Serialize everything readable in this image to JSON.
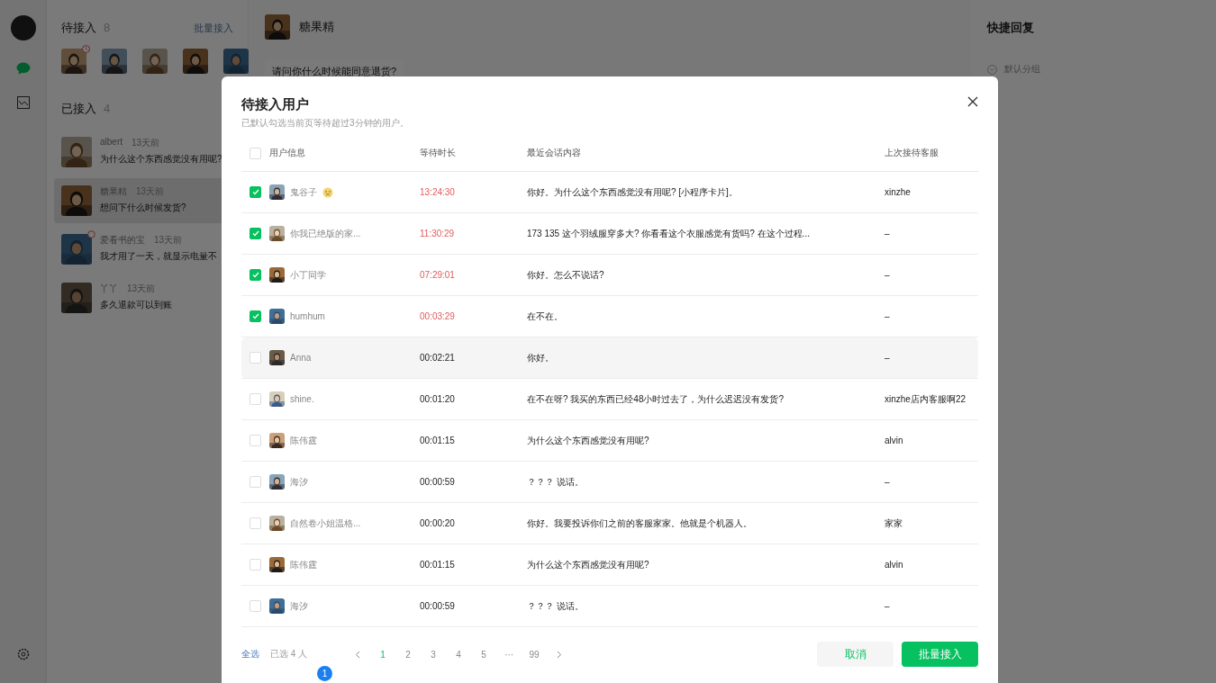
{
  "rail": {
    "nav": [
      {
        "kind": "chat",
        "selected": true
      },
      {
        "kind": "chart",
        "selected": false
      }
    ]
  },
  "waiting": {
    "title": "待接入",
    "count": "8",
    "action": "批量接入",
    "avatars": [
      {
        "alert": true
      },
      {
        "alert": false
      },
      {
        "alert": false
      },
      {
        "alert": false
      },
      {
        "alert": false
      }
    ]
  },
  "connected": {
    "title": "已接入",
    "count": "4",
    "items": [
      {
        "name": "albert",
        "time": "13天前",
        "message": "为什么这个东西感觉没有用呢?",
        "selected": false,
        "unread": false
      },
      {
        "name": "糖果精",
        "time": "13天前",
        "message": "想问下什么时候发货?",
        "selected": true,
        "unread": false
      },
      {
        "name": "爱看书的宝",
        "time": "13天前",
        "message": "我才用了一天，就显示电量不",
        "selected": false,
        "unread": true
      },
      {
        "name": "丫丫",
        "time": "13天前",
        "message": "多久退款可以到账",
        "selected": false,
        "unread": false
      }
    ]
  },
  "chat": {
    "name": "糖果精",
    "messages": [
      "请问你什么时候能同意退货?"
    ]
  },
  "quick_reply": {
    "title": "快捷回复",
    "groups": [
      {
        "label": "默认分组",
        "expanded": false
      }
    ]
  },
  "modal": {
    "title": "待接入用户",
    "subtitle": "已默认勾选当前页等待超过3分钟的用户。",
    "all_checked": false,
    "columns": [
      "用户信息",
      "等待时长",
      "最近会话内容",
      "上次接待客服"
    ],
    "rows": [
      {
        "name": "鬼谷子",
        "emoji": true,
        "wait": "13:24:30",
        "overdue": true,
        "message": "你好。为什么这个东西感觉没有用呢? [小程序卡片]。",
        "agent": "xinzhe",
        "checked": true,
        "hovered": false
      },
      {
        "name": "你我已绝版的家...",
        "emoji": false,
        "wait": "11:30:29",
        "overdue": true,
        "message": "173 135 这个羽绒服穿多大? 你看看这个衣服感觉有货吗? 在这个过程...",
        "agent": "–",
        "checked": true,
        "hovered": false
      },
      {
        "name": "小丁同学",
        "emoji": false,
        "wait": "07:29:01",
        "overdue": true,
        "message": "你好。怎么不说话?",
        "agent": "–",
        "checked": true,
        "hovered": false
      },
      {
        "name": "humhum",
        "emoji": false,
        "wait": "00:03:29",
        "overdue": true,
        "message": "在不在。",
        "agent": "–",
        "checked": true,
        "hovered": false
      },
      {
        "name": "Anna",
        "emoji": false,
        "wait": "00:02:21",
        "overdue": false,
        "message": "你好。",
        "agent": "–",
        "checked": false,
        "hovered": true
      },
      {
        "name": "shine.",
        "emoji": false,
        "wait": "00:01:20",
        "overdue": false,
        "message": "在不在呀? 我买的东西已经48小时过去了，为什么迟迟没有发货?",
        "agent": "xinzhe店内客服啊22",
        "checked": false,
        "hovered": false
      },
      {
        "name": "陈伟霆",
        "emoji": false,
        "wait": "00:01:15",
        "overdue": false,
        "message": "为什么这个东西感觉没有用呢?",
        "agent": "alvin",
        "checked": false,
        "hovered": false
      },
      {
        "name": "海汐",
        "emoji": false,
        "wait": "00:00:59",
        "overdue": false,
        "message": "？？？ 说话。",
        "agent": "–",
        "checked": false,
        "hovered": false
      },
      {
        "name": "自然卷小姐温格...",
        "emoji": false,
        "wait": "00:00:20",
        "overdue": false,
        "message": "你好。我要投诉你们之前的客服家家。他就是个机器人。",
        "agent": "家家",
        "checked": false,
        "hovered": false
      },
      {
        "name": "陈伟霆",
        "emoji": false,
        "wait": "00:01:15",
        "overdue": false,
        "message": "为什么这个东西感觉没有用呢?",
        "agent": "alvin",
        "checked": false,
        "hovered": false
      },
      {
        "name": "海汐",
        "emoji": false,
        "wait": "00:00:59",
        "overdue": false,
        "message": "？？？ 说话。",
        "agent": "–",
        "checked": false,
        "hovered": false
      }
    ],
    "footer": {
      "select_all": "全选",
      "selected_count": "已选 4 人",
      "pages": [
        {
          "label": "1",
          "selected": true
        },
        {
          "label": "2",
          "selected": false
        },
        {
          "label": "3",
          "selected": false
        },
        {
          "label": "4",
          "selected": false
        },
        {
          "label": "5",
          "selected": false
        },
        {
          "label": "···",
          "selected": false
        },
        {
          "label": "99",
          "selected": false
        }
      ],
      "cancel": "取消",
      "confirm": "批量接入"
    },
    "step_badge": "1"
  }
}
